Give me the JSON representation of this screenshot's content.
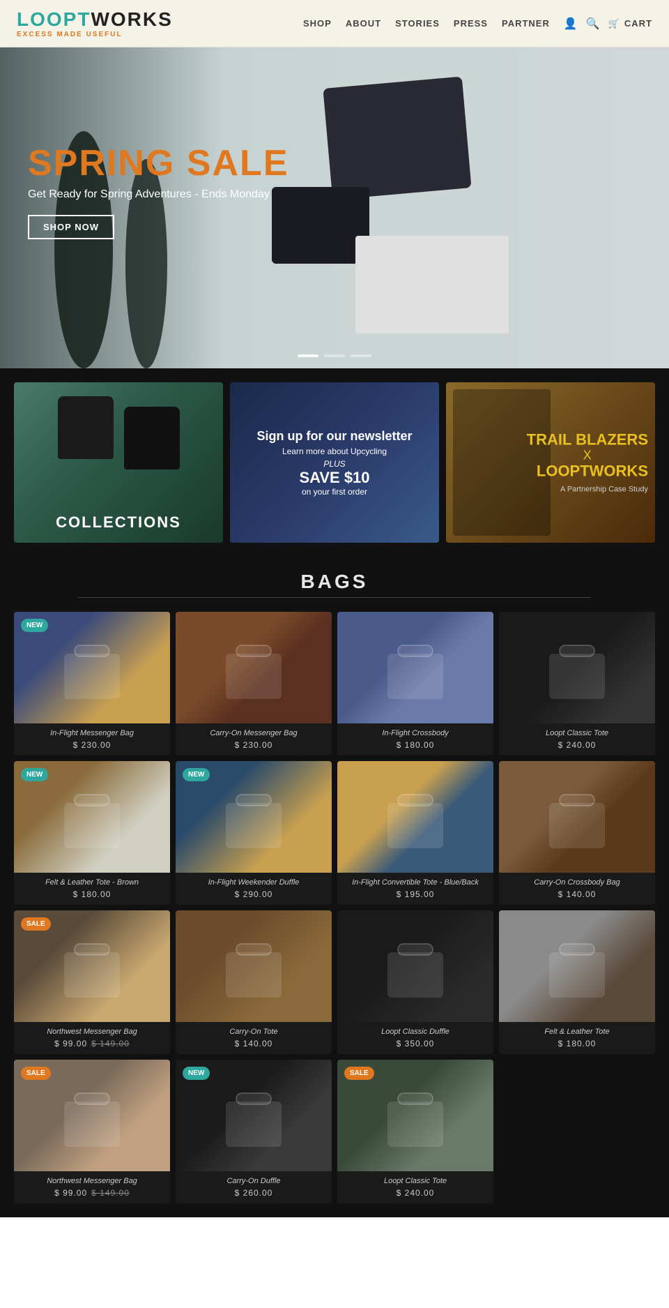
{
  "brand": {
    "name_loop": "LO",
    "name_oopt": "OPT",
    "name_works": "WORKS",
    "tagline": "EXCESS MADE USEFUL"
  },
  "nav": {
    "shop": "SHOP",
    "about": "ABOUT",
    "stories": "STORIES",
    "press": "PRESS",
    "partner": "PARTNER",
    "cart": "CART"
  },
  "hero": {
    "sale_title": "SPRING SALE",
    "subtitle": "Get Ready for Spring Adventures - Ends Monday",
    "cta": "SHOP NOW"
  },
  "promo_blocks": [
    {
      "id": "collections",
      "label": "COLLECTIONS"
    },
    {
      "id": "newsletter",
      "headline": "Sign up for our newsletter",
      "sub": "Learn more about Upcycling",
      "plus": "PLUS",
      "save": "SAVE $10",
      "first": "on your first order"
    },
    {
      "id": "trailblazer",
      "line1": "TRAIL BLAZERS",
      "line2": "X",
      "line3": "LOOPTWORKS",
      "sub": "A Partnership Case Study"
    }
  ],
  "bags_section": {
    "title": "BAGS",
    "products": [
      {
        "id": 1,
        "name": "In-Flight Messenger Bag",
        "price": "$ 230.00",
        "original_price": null,
        "badge": "NEW",
        "badge_type": "new",
        "img_class": "img-inflight-messenger"
      },
      {
        "id": 2,
        "name": "Carry-On Messenger Bag",
        "price": "$ 230.00",
        "original_price": null,
        "badge": null,
        "badge_type": null,
        "img_class": "img-carryon-messenger"
      },
      {
        "id": 3,
        "name": "In-Flight Crossbody",
        "price": "$ 180.00",
        "original_price": null,
        "badge": null,
        "badge_type": null,
        "img_class": "img-inflight-crossbody"
      },
      {
        "id": 4,
        "name": "Loopt Classic Tote",
        "price": "$ 240.00",
        "original_price": null,
        "badge": null,
        "badge_type": null,
        "img_class": "img-loopt-classic-tote"
      },
      {
        "id": 5,
        "name": "Felt & Leather Tote - Brown",
        "price": "$ 180.00",
        "original_price": null,
        "badge": "NEW",
        "badge_type": "new",
        "img_class": "img-felt-leather-brown"
      },
      {
        "id": 6,
        "name": "In-Flight Weekender Duffle",
        "price": "$ 290.00",
        "original_price": null,
        "badge": "NEW",
        "badge_type": "new",
        "img_class": "img-inflight-weekender"
      },
      {
        "id": 7,
        "name": "In-Flight Convertible Tote - Blue/Back",
        "price": "$ 195.00",
        "original_price": null,
        "badge": null,
        "badge_type": null,
        "img_class": "img-inflight-convertible"
      },
      {
        "id": 8,
        "name": "Carry-On Crossbody Bag",
        "price": "$ 140.00",
        "original_price": null,
        "badge": null,
        "badge_type": null,
        "img_class": "img-carryon-crossbody"
      },
      {
        "id": 9,
        "name": "Northwest Messenger Bag",
        "price": "$ 99.00",
        "original_price": "$ 149.00",
        "badge": "SALE",
        "badge_type": "sale",
        "img_class": "img-northwest-messenger"
      },
      {
        "id": 10,
        "name": "Carry-On Tote",
        "price": "$ 140.00",
        "original_price": null,
        "badge": null,
        "badge_type": null,
        "img_class": "img-carryon-tote"
      },
      {
        "id": 11,
        "name": "Loopt Classic Duffle",
        "price": "$ 350.00",
        "original_price": null,
        "badge": null,
        "badge_type": null,
        "img_class": "img-loopt-classic-duffle"
      },
      {
        "id": 12,
        "name": "Felt & Leather Tote",
        "price": "$ 180.00",
        "original_price": null,
        "badge": null,
        "badge_type": null,
        "img_class": "img-felt-leather-tote"
      },
      {
        "id": 13,
        "name": "Northwest Messenger Bag",
        "price": "$ 99.00",
        "original_price": "$ 149.00",
        "badge": "SALE",
        "badge_type": "sale",
        "img_class": "img-row4-1"
      },
      {
        "id": 14,
        "name": "Carry-On Duffle",
        "price": "$ 260.00",
        "original_price": null,
        "badge": "NEW",
        "badge_type": "new",
        "img_class": "img-row4-2"
      },
      {
        "id": 15,
        "name": "Loopt Classic Tote",
        "price": "$ 240.00",
        "original_price": null,
        "badge": "SALE",
        "badge_type": "sale",
        "img_class": "img-row4-3"
      }
    ]
  }
}
